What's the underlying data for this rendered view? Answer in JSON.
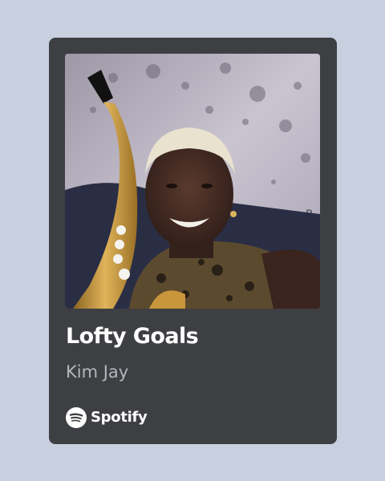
{
  "track": {
    "title": "Lofty Goals",
    "artist": "Kim Jay"
  },
  "branding": {
    "wordmark": "Spotify",
    "icon": "spotify-icon"
  },
  "artwork": {
    "description_icon": "album-art-image"
  },
  "colors": {
    "page_background": "#c8d0e0",
    "card_background": "#3e3f43",
    "title_color": "#ffffff",
    "artist_color": "#b5b6bc"
  }
}
